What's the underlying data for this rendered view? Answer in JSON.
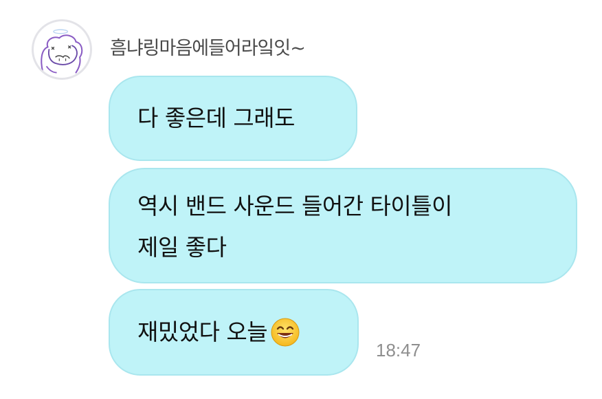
{
  "chat": {
    "sender_name": "흠냐링마음에들어라잌잇~",
    "avatar_icon": "hand-drawn-character-avatar-icon",
    "messages": [
      {
        "text": "다 좋은데 그래도"
      },
      {
        "text": "역시 밴드 사운드 들어간 타이틀이\n제일 좋다"
      },
      {
        "text": "재밌었다 오늘",
        "emoji": "grinning-face-with-smiling-eyes"
      }
    ],
    "timestamp": "18:47"
  },
  "colors": {
    "bubble_fill": "#bff3f8",
    "bubble_border": "#a9e6ee",
    "avatar_doodle": "#8a5cc4"
  }
}
